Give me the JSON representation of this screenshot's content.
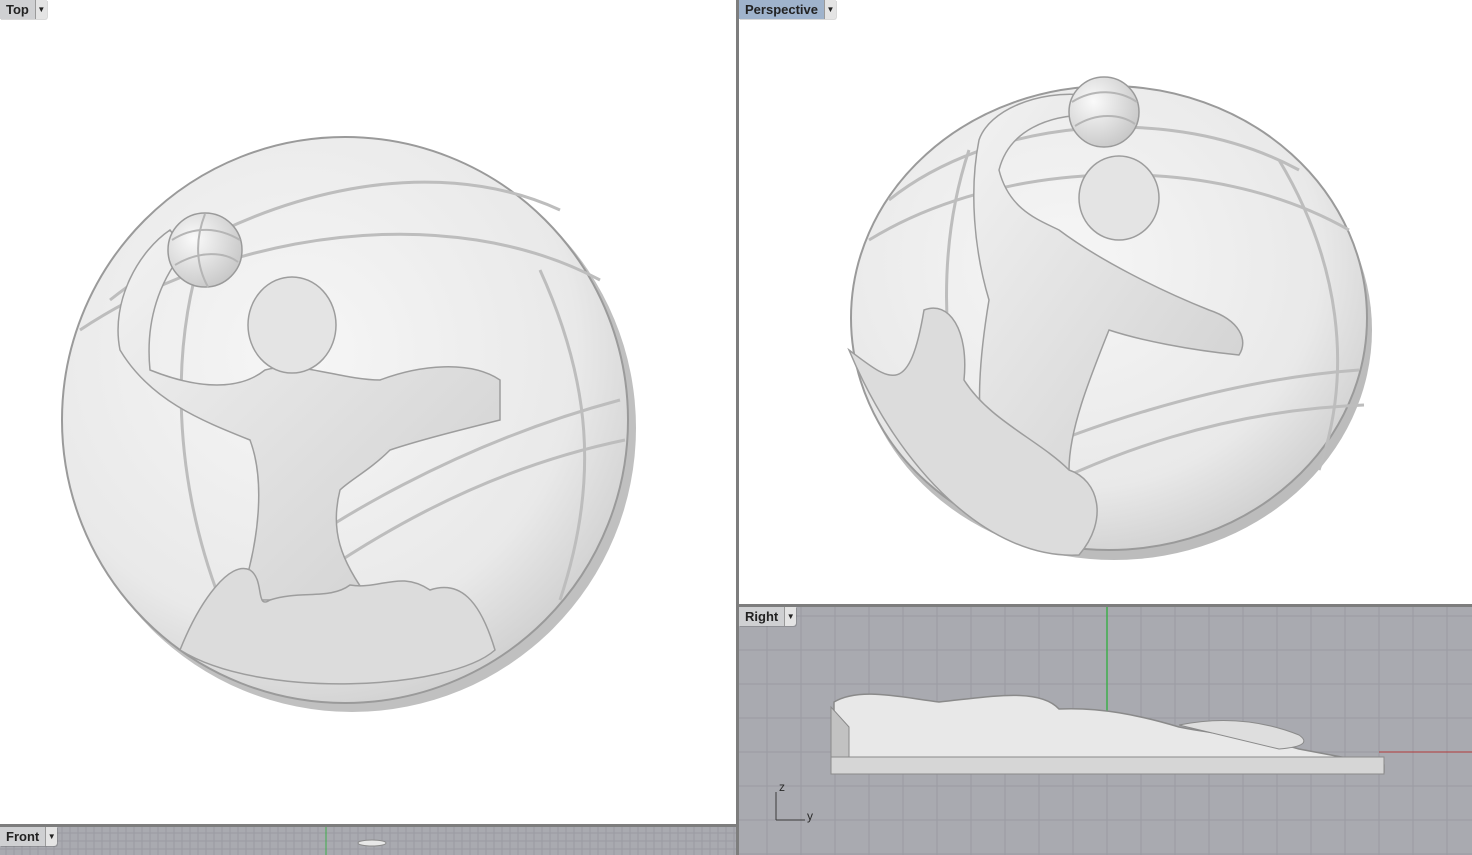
{
  "viewports": {
    "top": {
      "label": "Top"
    },
    "perspective": {
      "label": "Perspective",
      "active": true
    },
    "right": {
      "label": "Right",
      "axis_z": "z",
      "axis_y": "y"
    },
    "front": {
      "label": "Front"
    }
  },
  "icons": {
    "dropdown": "chevron-down-icon"
  },
  "colors": {
    "viewport_bg": "#ffffff",
    "ortho_bg": "#a9aab0",
    "grid_line": "#9a9ba2",
    "axis_green": "#3fae4c",
    "axis_red": "#b33a3a",
    "active_tab": "#9fb3cc",
    "inactive_tab": "#cfd0d2"
  }
}
